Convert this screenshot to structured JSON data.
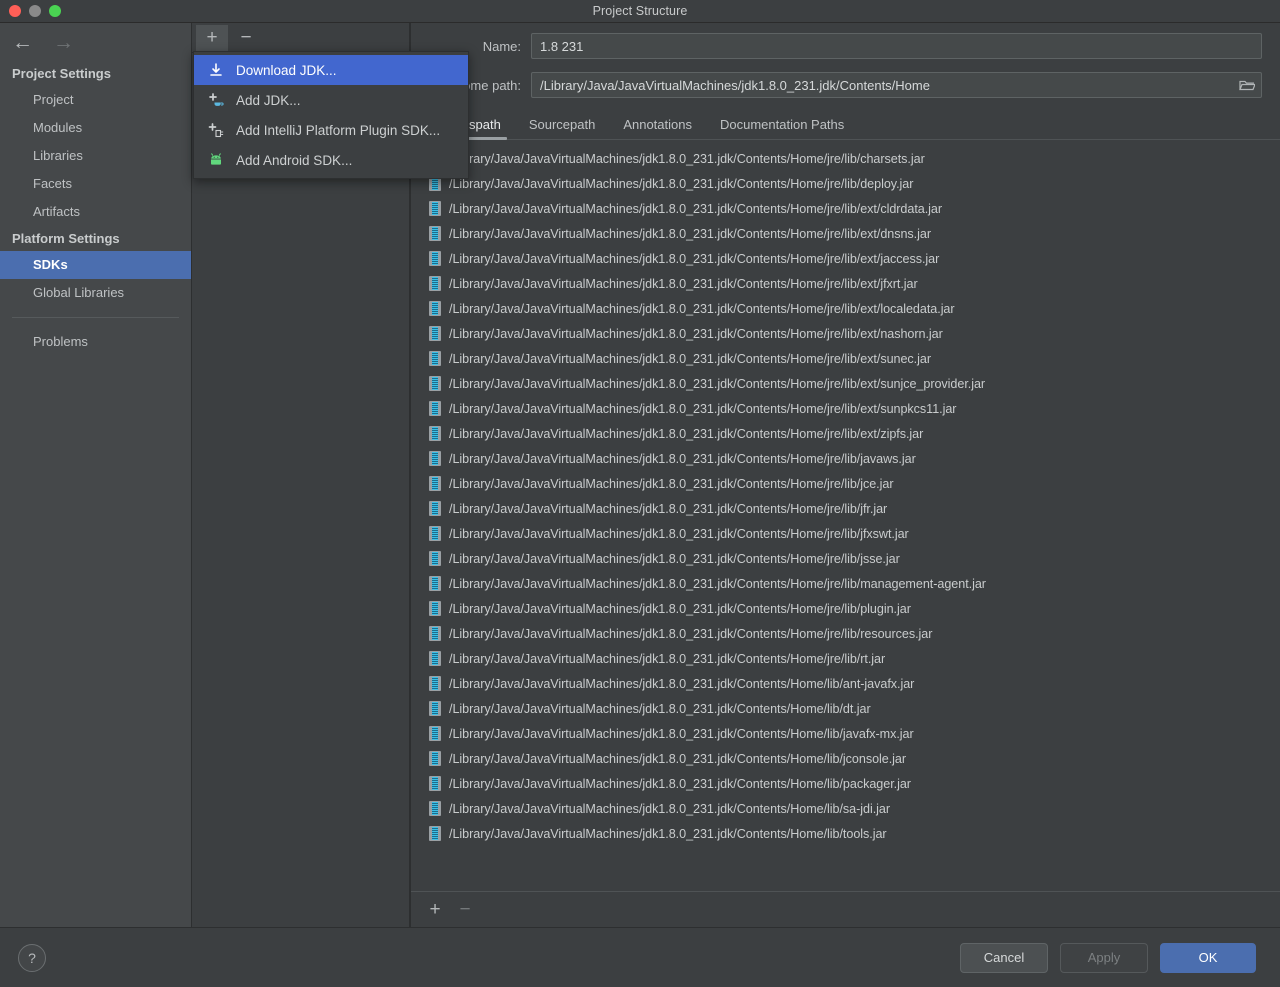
{
  "window": {
    "title": "Project Structure",
    "traffic_lights": [
      "close-red",
      "minimize-gray",
      "zoom-green"
    ]
  },
  "sidebar": {
    "back_arrow": "←",
    "forward_arrow": "→",
    "sections": [
      {
        "heading": "Project Settings",
        "items": [
          {
            "label": "Project",
            "selected": false
          },
          {
            "label": "Modules",
            "selected": false
          },
          {
            "label": "Libraries",
            "selected": false
          },
          {
            "label": "Facets",
            "selected": false
          },
          {
            "label": "Artifacts",
            "selected": false
          }
        ]
      },
      {
        "heading": "Platform Settings",
        "items": [
          {
            "label": "SDKs",
            "selected": true
          },
          {
            "label": "Global Libraries",
            "selected": false
          }
        ]
      }
    ],
    "extra_items": [
      {
        "label": "Problems",
        "selected": false
      }
    ]
  },
  "sdk_toolbar": {
    "add_label": "+",
    "remove_label": "−"
  },
  "popup_menu": {
    "items": [
      {
        "label": "Download JDK...",
        "icon": "download-icon",
        "highlighted": true
      },
      {
        "label": "Add JDK...",
        "icon": "add-jdk-coffee-icon",
        "highlighted": false
      },
      {
        "label": "Add IntelliJ Platform Plugin SDK...",
        "icon": "add-plugin-sdk-icon",
        "highlighted": false
      },
      {
        "label": "Add Android SDK...",
        "icon": "android-robot-icon",
        "highlighted": false
      }
    ]
  },
  "detail": {
    "name_label": "Name:",
    "name_value": "1.8 231",
    "home_path_label": "JDK home path:",
    "home_path_value": "/Library/Java/JavaVirtualMachines/jdk1.8.0_231.jdk/Contents/Home",
    "browse_icon": "folder-icon",
    "tabs": [
      {
        "label": "Classpath",
        "active": true
      },
      {
        "label": "Sourcepath",
        "active": false
      },
      {
        "label": "Annotations",
        "active": false
      },
      {
        "label": "Documentation Paths",
        "active": false
      }
    ],
    "classpath_entries": [
      "/Library/Java/JavaVirtualMachines/jdk1.8.0_231.jdk/Contents/Home/jre/lib/charsets.jar",
      "/Library/Java/JavaVirtualMachines/jdk1.8.0_231.jdk/Contents/Home/jre/lib/deploy.jar",
      "/Library/Java/JavaVirtualMachines/jdk1.8.0_231.jdk/Contents/Home/jre/lib/ext/cldrdata.jar",
      "/Library/Java/JavaVirtualMachines/jdk1.8.0_231.jdk/Contents/Home/jre/lib/ext/dnsns.jar",
      "/Library/Java/JavaVirtualMachines/jdk1.8.0_231.jdk/Contents/Home/jre/lib/ext/jaccess.jar",
      "/Library/Java/JavaVirtualMachines/jdk1.8.0_231.jdk/Contents/Home/jre/lib/ext/jfxrt.jar",
      "/Library/Java/JavaVirtualMachines/jdk1.8.0_231.jdk/Contents/Home/jre/lib/ext/localedata.jar",
      "/Library/Java/JavaVirtualMachines/jdk1.8.0_231.jdk/Contents/Home/jre/lib/ext/nashorn.jar",
      "/Library/Java/JavaVirtualMachines/jdk1.8.0_231.jdk/Contents/Home/jre/lib/ext/sunec.jar",
      "/Library/Java/JavaVirtualMachines/jdk1.8.0_231.jdk/Contents/Home/jre/lib/ext/sunjce_provider.jar",
      "/Library/Java/JavaVirtualMachines/jdk1.8.0_231.jdk/Contents/Home/jre/lib/ext/sunpkcs11.jar",
      "/Library/Java/JavaVirtualMachines/jdk1.8.0_231.jdk/Contents/Home/jre/lib/ext/zipfs.jar",
      "/Library/Java/JavaVirtualMachines/jdk1.8.0_231.jdk/Contents/Home/jre/lib/javaws.jar",
      "/Library/Java/JavaVirtualMachines/jdk1.8.0_231.jdk/Contents/Home/jre/lib/jce.jar",
      "/Library/Java/JavaVirtualMachines/jdk1.8.0_231.jdk/Contents/Home/jre/lib/jfr.jar",
      "/Library/Java/JavaVirtualMachines/jdk1.8.0_231.jdk/Contents/Home/jre/lib/jfxswt.jar",
      "/Library/Java/JavaVirtualMachines/jdk1.8.0_231.jdk/Contents/Home/jre/lib/jsse.jar",
      "/Library/Java/JavaVirtualMachines/jdk1.8.0_231.jdk/Contents/Home/jre/lib/management-agent.jar",
      "/Library/Java/JavaVirtualMachines/jdk1.8.0_231.jdk/Contents/Home/jre/lib/plugin.jar",
      "/Library/Java/JavaVirtualMachines/jdk1.8.0_231.jdk/Contents/Home/jre/lib/resources.jar",
      "/Library/Java/JavaVirtualMachines/jdk1.8.0_231.jdk/Contents/Home/jre/lib/rt.jar",
      "/Library/Java/JavaVirtualMachines/jdk1.8.0_231.jdk/Contents/Home/lib/ant-javafx.jar",
      "/Library/Java/JavaVirtualMachines/jdk1.8.0_231.jdk/Contents/Home/lib/dt.jar",
      "/Library/Java/JavaVirtualMachines/jdk1.8.0_231.jdk/Contents/Home/lib/javafx-mx.jar",
      "/Library/Java/JavaVirtualMachines/jdk1.8.0_231.jdk/Contents/Home/lib/jconsole.jar",
      "/Library/Java/JavaVirtualMachines/jdk1.8.0_231.jdk/Contents/Home/lib/packager.jar",
      "/Library/Java/JavaVirtualMachines/jdk1.8.0_231.jdk/Contents/Home/lib/sa-jdi.jar",
      "/Library/Java/JavaVirtualMachines/jdk1.8.0_231.jdk/Contents/Home/lib/tools.jar"
    ],
    "list_toolbar": {
      "add_label": "+",
      "remove_label": "−"
    }
  },
  "footer": {
    "help_label": "?",
    "cancel_label": "Cancel",
    "apply_label": "Apply",
    "ok_label": "OK"
  },
  "colors": {
    "window_bg": "#3c3f41",
    "sidebar_bg": "#45484a",
    "selection_blue": "#4b6eaf",
    "menu_highlight_blue": "#4267cf",
    "primary_button": "#4b6eaf",
    "text": "#c9cccd"
  }
}
